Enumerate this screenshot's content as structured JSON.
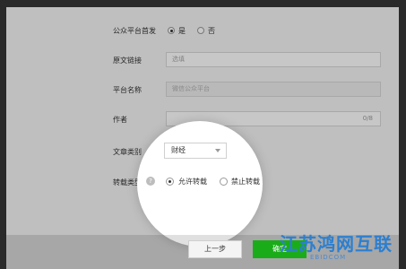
{
  "form": {
    "first_publish_label": "公众平台首发",
    "first_publish_yes": "是",
    "first_publish_no": "否",
    "original_link_label": "原文链接",
    "original_link_placeholder": "选填",
    "platform_name_label": "平台名称",
    "platform_name_value": "微信公众平台",
    "author_label": "作者",
    "author_counter": "0/8",
    "category_label": "文章类别",
    "category_value": "财经",
    "reprint_label": "转载类型",
    "reprint_allow": "允许转载",
    "reprint_forbid": "禁止转载"
  },
  "footer": {
    "prev_label": "上一步",
    "next_label": "确定"
  },
  "watermark": {
    "text": "江苏鸿网互联",
    "sub": "EBIDCOM"
  },
  "colors": {
    "accent": "#1aad19",
    "watermark": "#2c7fd0"
  }
}
